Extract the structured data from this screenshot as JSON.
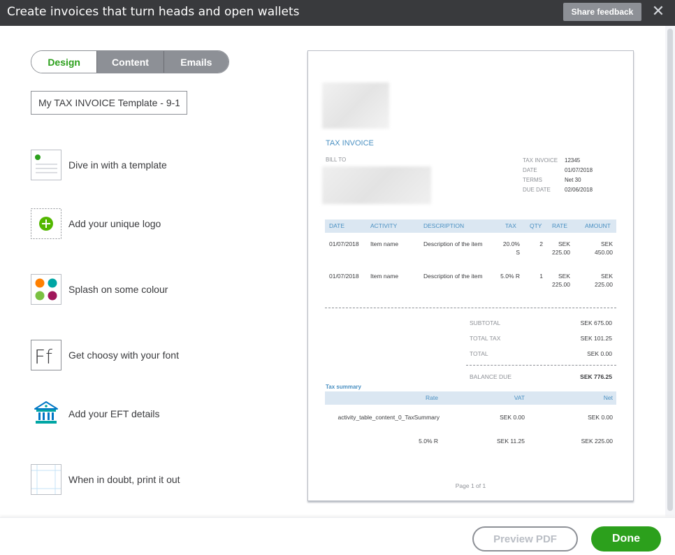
{
  "header": {
    "title": "Create invoices that turn heads and open wallets",
    "feedback_label": "Share feedback",
    "close_glyph": "✕"
  },
  "tabs": [
    {
      "label": "Design",
      "active": true
    },
    {
      "label": "Content",
      "active": false
    },
    {
      "label": "Emails",
      "active": false
    }
  ],
  "template_name": "My TAX INVOICE Template - 9-1",
  "features": [
    {
      "icon": "template-icon",
      "label": "Dive in with a template"
    },
    {
      "icon": "logo-add-icon",
      "label": "Add your unique logo"
    },
    {
      "icon": "colour-palette-icon",
      "label": "Splash on some colour"
    },
    {
      "icon": "font-icon",
      "label": "Get choosy with your font"
    },
    {
      "icon": "bank-icon",
      "label": "Add your EFT details"
    },
    {
      "icon": "print-margins-icon",
      "label": "When in doubt, print it out"
    }
  ],
  "invoice": {
    "title": "TAX INVOICE",
    "bill_to": "BILL TO",
    "meta": [
      {
        "key": "TAX INVOICE",
        "value": "12345"
      },
      {
        "key": "DATE",
        "value": "01/07/2018"
      },
      {
        "key": "TERMS",
        "value": "Net 30"
      },
      {
        "key": "DUE DATE",
        "value": "02/06/2018"
      }
    ],
    "columns": [
      "DATE",
      "ACTIVITY",
      "DESCRIPTION",
      "TAX",
      "QTY",
      "RATE",
      "AMOUNT"
    ],
    "rows": [
      {
        "date": "01/07/2018",
        "activity": "Item name",
        "description": "Description of the item",
        "tax": "20.0% S",
        "qty": "2",
        "rate": "SEK 225.00",
        "amount": "SEK 450.00"
      },
      {
        "date": "01/07/2018",
        "activity": "Item name",
        "description": "Description of the item",
        "tax": "5.0% R",
        "qty": "1",
        "rate": "SEK 225.00",
        "amount": "SEK 225.00"
      }
    ],
    "summary": [
      {
        "key": "SUBTOTAL",
        "value": "SEK 675.00"
      },
      {
        "key": "TOTAL TAX",
        "value": "SEK 101.25"
      },
      {
        "key": "TOTAL",
        "value": "SEK 0.00"
      }
    ],
    "balance_due": {
      "key": "BALANCE DUE",
      "value": "SEK 776.25"
    },
    "tax_summary": {
      "title": "Tax summary",
      "columns": [
        "Rate",
        "VAT",
        "Net"
      ],
      "rows": [
        {
          "rate": "activity_table_content_0_TaxSummary",
          "vat": "SEK 0.00",
          "net": "SEK 0.00"
        },
        {
          "rate": "5.0% R",
          "vat": "SEK 11.25",
          "net": "SEK 225.00"
        }
      ]
    },
    "page": "Page 1 of 1"
  },
  "footer": {
    "preview_label": "Preview PDF",
    "done_label": "Done"
  },
  "colors": {
    "header_bg": "#393a3d",
    "accent_green": "#2ca01c",
    "invoice_blue": "#4a90c2"
  }
}
